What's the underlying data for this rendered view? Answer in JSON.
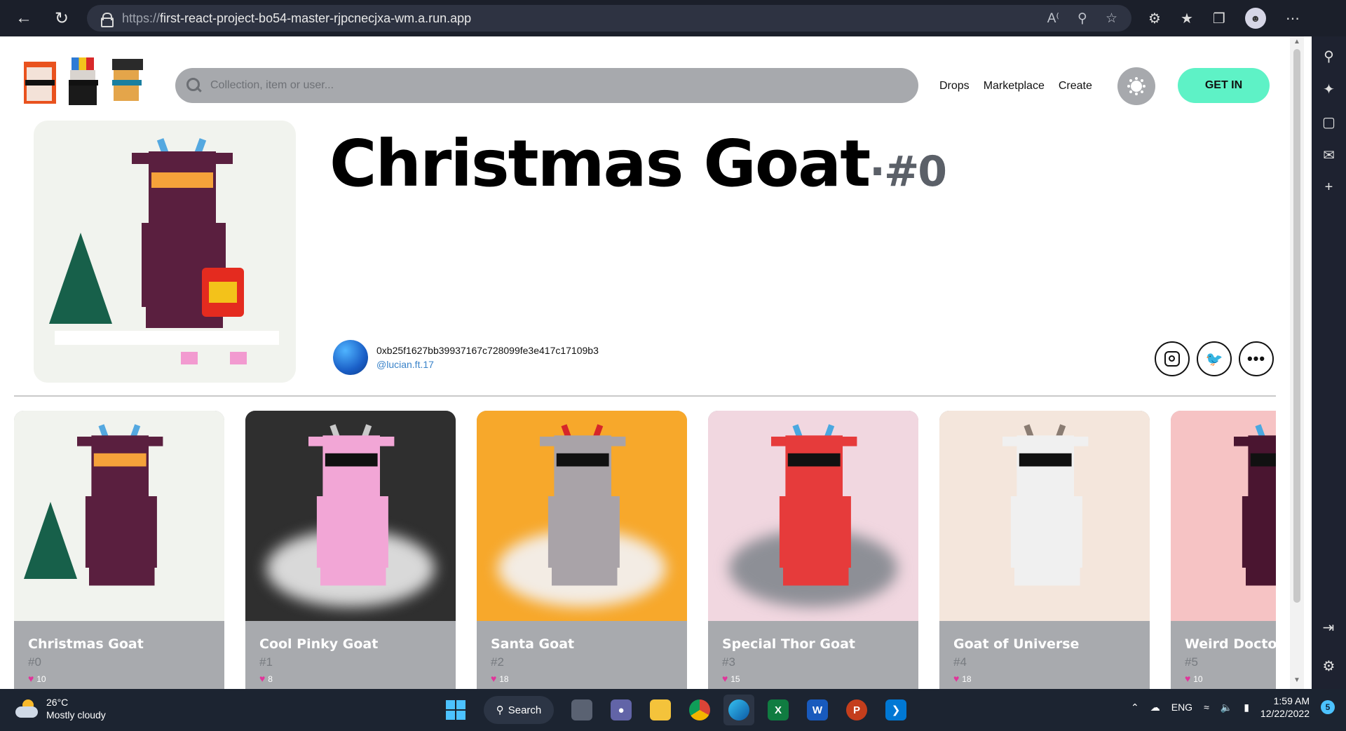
{
  "browser": {
    "url_protocol": "https://",
    "url_host": "first-react-project-bo54-master-rjpcnecjxa-wm.a.run.app"
  },
  "header": {
    "search_placeholder": "Collection, item or user...",
    "nav": [
      "Drops",
      "Marketplace",
      "Create"
    ],
    "cta_label": "GET IN"
  },
  "hero": {
    "title": "Christmas Goat",
    "number": "·#0",
    "owner_address": "0xb25f1627bb39937167c728099fe3e417c17109b3",
    "owner_handle": "@lucian.ft.17"
  },
  "cards": [
    {
      "name": "Christmas Goat",
      "number": "#0",
      "likes": "10",
      "bg": "#f1f3ee",
      "goat": "#5a1f3f",
      "horn": "#54a8e0"
    },
    {
      "name": "Cool Pinky Goat",
      "number": "#1",
      "likes": "8",
      "bg": "#2f2f2f",
      "goat": "#f2a6d6",
      "horn": "#c9c9c9"
    },
    {
      "name": "Santa Goat",
      "number": "#2",
      "likes": "18",
      "bg": "#f7a82b",
      "goat": "#a9a3a8",
      "horn": "#d6262a"
    },
    {
      "name": "Special Thor Goat",
      "number": "#3",
      "likes": "15",
      "bg": "#f1d7e0",
      "goat": "#e63b3b",
      "horn": "#4aa8e0"
    },
    {
      "name": "Goat of Universe",
      "number": "#4",
      "likes": "18",
      "bg": "#f4e6dc",
      "goat": "#f0f0f0",
      "horn": "#8a7c72"
    },
    {
      "name": "Weird Doctor",
      "number": "#5",
      "likes": "10",
      "bg": "#f6c3c4",
      "goat": "#4a1530",
      "horn": "#4aa8e0"
    }
  ],
  "taskbar": {
    "temp": "26°C",
    "weather": "Mostly cloudy",
    "search_label": "Search",
    "lang": "ENG",
    "time": "1:59 AM",
    "date": "12/22/2022",
    "notif_count": "5"
  }
}
